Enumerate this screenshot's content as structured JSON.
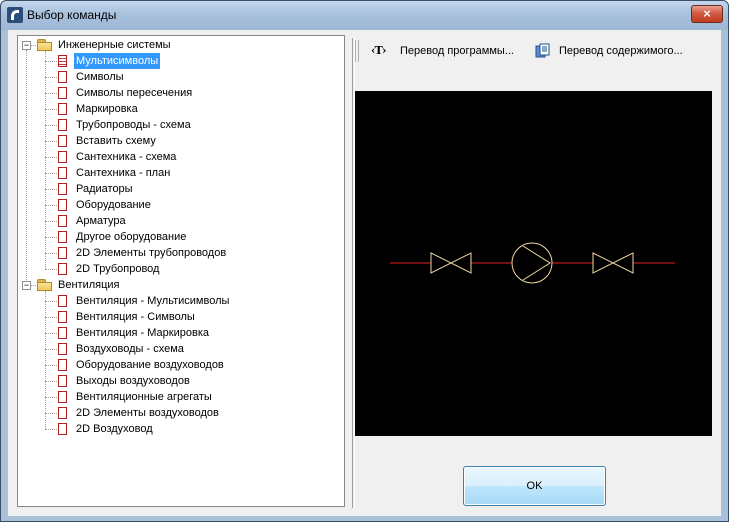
{
  "window": {
    "title": "Выбор команды",
    "close_glyph": "×"
  },
  "tree": {
    "groups": [
      {
        "label": "Инженерные системы",
        "expander": "−",
        "items": [
          "Мультисимволы",
          "Символы",
          "Символы пересечения",
          "Маркировка",
          "Трубопроводы - схема",
          "Вставить схему",
          "Сантехника - схема",
          "Сантехника - план",
          "Радиаторы",
          "Оборудование",
          "Арматура",
          "Другое оборудование",
          "2D Элементы трубопроводов",
          "2D Трубопровод"
        ]
      },
      {
        "label": "Вентиляция",
        "expander": "−",
        "items": [
          "Вентиляция - Мультисимволы",
          "Вентиляция - Символы",
          "Вентиляция - Маркировка",
          "Воздуховоды - схема",
          "Оборудование воздуховодов",
          "Выходы воздуховодов",
          "Вентиляционные агрегаты",
          "2D Элементы воздуховодов",
          "2D Воздуховод"
        ]
      }
    ],
    "selected": "Мультисимволы"
  },
  "toolbar": {
    "translate_program": {
      "icon": "text-t-icon",
      "glyph": "‹T›",
      "label": "Перевод программы..."
    },
    "translate_content": {
      "icon": "translate-document-icon",
      "label": "Перевод содержимого..."
    }
  },
  "preview": {
    "background": "#000000",
    "line_color": "#e02020",
    "symbol_color": "#f0d8a0"
  },
  "ok_button": {
    "label": "OK"
  }
}
